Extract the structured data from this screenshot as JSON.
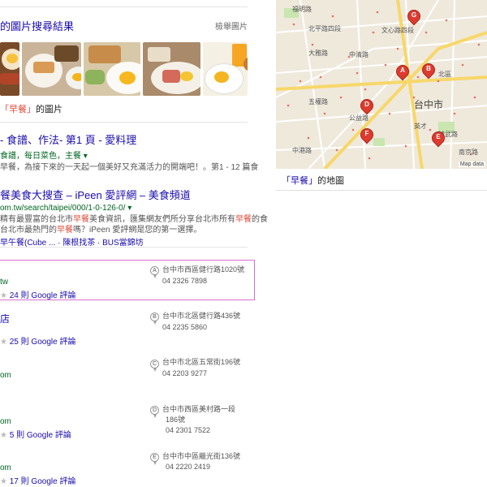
{
  "images": {
    "header_title": "的圖片搜尋結果",
    "more_link": "檢舉圖片",
    "caption_query": "「早餐」",
    "caption_suffix": "的圖片"
  },
  "results": [
    {
      "title": "- 食譜、作法- 第1 頁 - 愛料理",
      "url": "食譜，每日菜色，主餐",
      "snippet": "早餐，為接下來的一天起一個美好又充滿活力的開端吧！。第1 - 12 篇食"
    },
    {
      "title": "餐美食大搜查 – iPeen 愛評網 – 美食頻道",
      "url": "om.tw/search/taipei/000/1-0-126-0/",
      "snippet_parts": [
        "精有最豐富的台北市",
        "早餐",
        "美食資訊，匯集網友們所分享台北市所有",
        "早餐",
        "的食"
      ],
      "snippet2_parts": [
        "台北市最熱門的",
        "早餐",
        "嗎？iPeen 愛評網是您的第一選擇。"
      ],
      "sitelinks": "早午餐(Cube ... · 陳根找茶 · BUS當錦坊"
    }
  ],
  "local": [
    {
      "letter": "A",
      "name": "",
      "site": "tw",
      "reviews": "24 則 Google 評論",
      "addr1": "台中市西區健行路1020號",
      "addr2": "04 2326 7898"
    },
    {
      "letter": "B",
      "name": "店",
      "site": "",
      "reviews": "25 則 Google 評論",
      "addr1": "台中市北區健行路436號",
      "addr2": "04 2235 5860"
    },
    {
      "letter": "C",
      "name": "",
      "site": "om",
      "reviews": "",
      "addr1": "台中市北區五常街196號",
      "addr2": "04 2203 9277"
    },
    {
      "letter": "D",
      "name": "",
      "site": "om",
      "reviews": "5 則 Google 評論",
      "addr1": "台中市西區美村路一段",
      "addr1b": "186號",
      "addr2": "04 2301 7522"
    },
    {
      "letter": "E",
      "name": "",
      "site": "om",
      "reviews": "17 則 Google 評論",
      "addr1": "台中市中區繼光街136號",
      "addr2": "04 2220 2419"
    }
  ],
  "map": {
    "caption_query": "「早餐」",
    "caption_suffix": "的地圖",
    "city": "台中市",
    "data_note": "Map data",
    "labels": [
      "福明路",
      "北平路四段",
      "文心路四段",
      "中清路",
      "北區",
      "英才",
      "公益路",
      "精武路",
      "南京路",
      "五權路",
      "大雅路",
      "中港路"
    ],
    "pins": [
      "G",
      "A",
      "B",
      "D",
      "F",
      "E"
    ]
  },
  "colors": {
    "link": "#1a0dab",
    "url": "#006621",
    "highlight": "#dd4b39",
    "pin_red": "#dd3b2f"
  }
}
